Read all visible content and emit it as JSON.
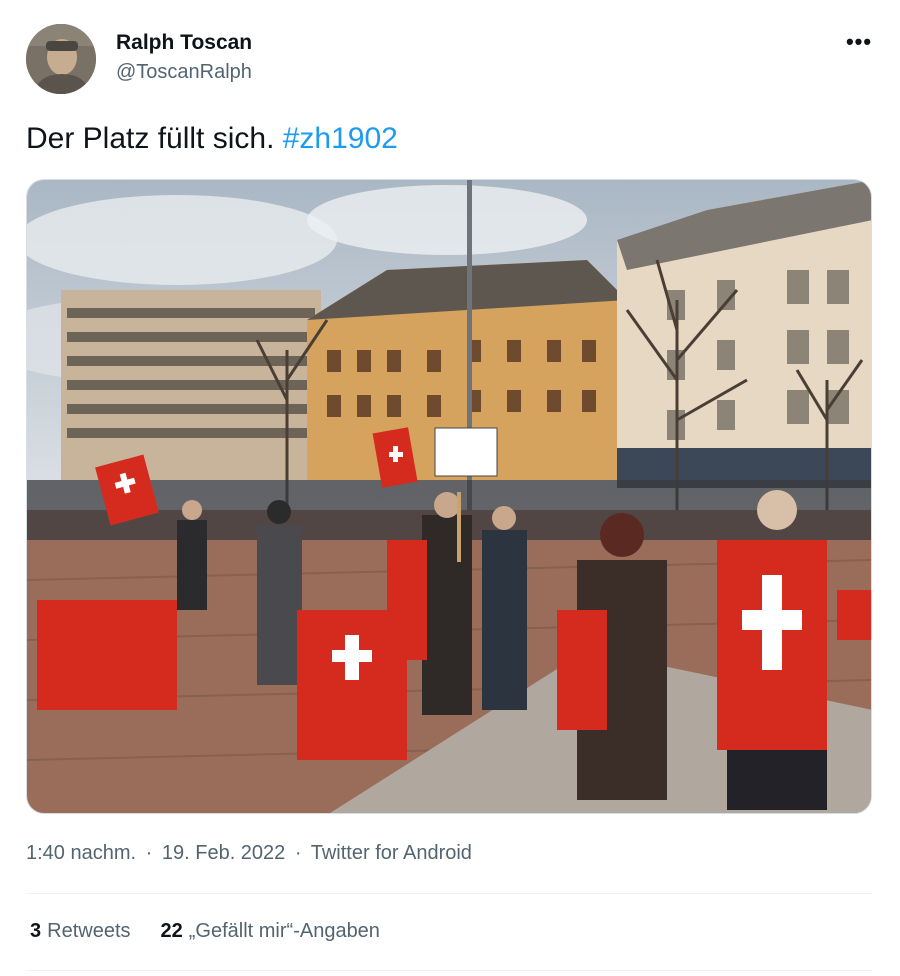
{
  "author": {
    "name": "Ralph Toscan",
    "handle": "@ToscanRalph",
    "avatar_icon": "profile-photo"
  },
  "menu": {
    "more_label": "•••"
  },
  "tweet": {
    "text": "Der Platz füllt sich. ",
    "hashtag": "#zh1902",
    "photo_alt_icon": "photo-demonstration-crowd-swiss-flags"
  },
  "meta": {
    "time": "1:40 nachm.",
    "separator": "·",
    "date": "19. Feb. 2022",
    "source": "Twitter for Android"
  },
  "stats": {
    "retweets_count": "3",
    "retweets_label": "Retweets",
    "likes_count": "22",
    "likes_label": "„Gefällt mir“-Angaben"
  },
  "colors": {
    "text_primary": "#0f1419",
    "text_secondary": "#536471",
    "hashtag": "#1d9bf0",
    "swiss_red": "#d52b1e"
  }
}
